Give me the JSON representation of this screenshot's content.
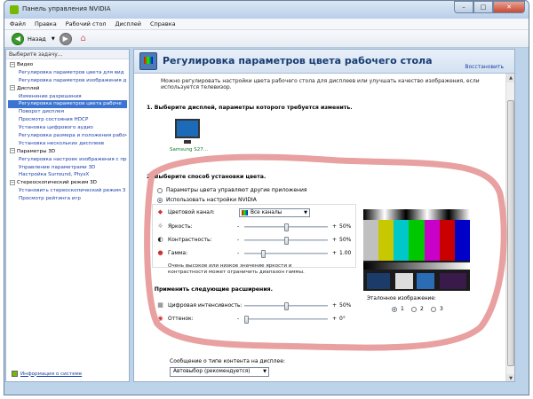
{
  "window": {
    "title": "Панель управления NVIDIA",
    "min_glyph": "–",
    "max_glyph": "□",
    "close_glyph": "✕"
  },
  "menu": [
    "Файл",
    "Правка",
    "Рабочий стол",
    "Дисплей",
    "Справка"
  ],
  "toolbar": {
    "back_label": "Назад",
    "back_icon": "back-arrow-icon",
    "forward_icon": "forward-arrow-icon",
    "home_icon": "home-icon"
  },
  "sidebar": {
    "header": "Выберите задачу...",
    "tree": [
      {
        "type": "cat",
        "label": "Видео"
      },
      {
        "type": "child",
        "label": "Регулировка параметров цвета для вид"
      },
      {
        "type": "child",
        "label": "Регулировка параметров изображения д"
      },
      {
        "type": "cat",
        "label": "Дисплей"
      },
      {
        "type": "child",
        "label": "Изменение разрешения"
      },
      {
        "type": "child",
        "label": "Регулировка параметров цвета рабоче",
        "selected": true
      },
      {
        "type": "child",
        "label": "Поворот дисплея"
      },
      {
        "type": "child",
        "label": "Просмотр состояния HDCP"
      },
      {
        "type": "child",
        "label": "Установка цифрового аудио"
      },
      {
        "type": "child",
        "label": "Регулировка размера и положения рабоч"
      },
      {
        "type": "child",
        "label": "Установка нескольких дисплеев"
      },
      {
        "type": "cat",
        "label": "Параметры 3D"
      },
      {
        "type": "child",
        "label": "Регулировка настроек изображения с пр"
      },
      {
        "type": "child",
        "label": "Управление параметрами 3D"
      },
      {
        "type": "child",
        "label": "Настройка Surround, PhysX"
      },
      {
        "type": "cat",
        "label": "Стереоскопический режим 3D"
      },
      {
        "type": "child",
        "label": "Установить стереоскопический режим 3"
      },
      {
        "type": "child",
        "label": "Просмотр рейтинга игр"
      }
    ],
    "system_info": "Информация о системе"
  },
  "page": {
    "title": "Регулировка параметров цвета рабочего стола",
    "restore": "Восстановить",
    "description": "Можно регулировать настройки цвета рабочего стола для дисплеев или улучшать качество изображения, если используется телевизор.",
    "step1": "1. Выберите дисплей, параметры которого требуется изменить.",
    "display_name": "Samsung S27...",
    "step2": "2. Выберите способ установки цвета.",
    "radio_other": "Параметры цвета управляют другие приложения",
    "radio_nvidia": "Использовать настройки NVIDIA",
    "color_channel_label": "Цветовой канал:",
    "color_channel_value": "Все каналы",
    "brightness": {
      "label": "Яркость:",
      "value": "50%",
      "level": 0.5
    },
    "contrast": {
      "label": "Контрастность:",
      "value": "50%",
      "level": 0.5
    },
    "gamma": {
      "label": "Гамма:",
      "value": "1.00",
      "level": 0.21
    },
    "note": "Очень высокое или низкое значение яркости и контрастности может ограничить диапазон гаммы.",
    "step3": "3. Применить следующие расширения.",
    "vibrance": {
      "label": "Цифровая интенсивность:",
      "value": "50%",
      "level": 0.5
    },
    "hue": {
      "label": "Оттенок:",
      "value": "0°",
      "level": 0.0
    },
    "minus": "-",
    "plus": "+",
    "reference_label": "Эталонное изображение:",
    "reference_options": [
      "1",
      "2",
      "3"
    ],
    "content_type_label": "Сообщение о типе контента на дисплее:",
    "content_type_value": "Автовыбор (рекомендуется)"
  },
  "colors": {
    "annotation": "#e8a0a0",
    "bars": [
      "#c0c0c0",
      "#c8c800",
      "#00c8c8",
      "#00c800",
      "#c800c8",
      "#c80000",
      "#0000c8"
    ]
  }
}
